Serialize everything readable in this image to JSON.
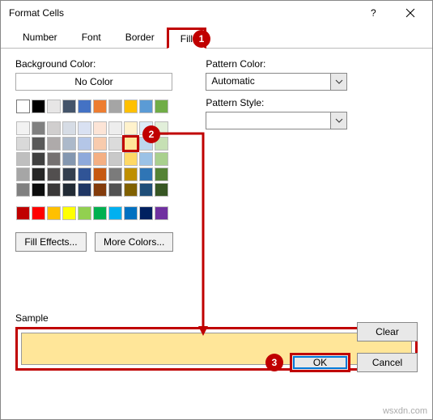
{
  "title": "Format Cells",
  "tabs": {
    "number": "Number",
    "font": "Font",
    "border": "Border",
    "fill": "Fill"
  },
  "callouts": {
    "tab": "1",
    "swatch": "2",
    "ok": "3"
  },
  "bg_label": "Background Color:",
  "no_color": "No Color",
  "pattern_color_label": "Pattern Color:",
  "pattern_color_value": "Automatic",
  "pattern_style_label": "Pattern Style:",
  "fill_effects": "Fill Effects...",
  "more_colors": "More Colors...",
  "sample_label": "Sample",
  "clear": "Clear",
  "ok": "OK",
  "cancel": "Cancel",
  "watermark": "wsxdn.com",
  "theme_colors_row1": [
    "#ffffff",
    "#000000",
    "#e7e6e6",
    "#44546a",
    "#4472c4",
    "#ed7d31",
    "#a5a5a5",
    "#ffc000",
    "#5b9bd5",
    "#70ad47"
  ],
  "theme_tints": [
    [
      "#f2f2f2",
      "#808080",
      "#d0cece",
      "#d6dce5",
      "#d9e1f2",
      "#fce4d6",
      "#ededed",
      "#fff2cc",
      "#ddebf7",
      "#e2efda"
    ],
    [
      "#d9d9d9",
      "#595959",
      "#aeaaaa",
      "#acb9ca",
      "#b4c6e7",
      "#f8cbad",
      "#dbdbdb",
      "#ffe699",
      "#bdd7ee",
      "#c6e0b4"
    ],
    [
      "#bfbfbf",
      "#404040",
      "#757171",
      "#8497b0",
      "#8ea9db",
      "#f4b084",
      "#c9c9c9",
      "#ffd966",
      "#9bc2e6",
      "#a9d08e"
    ],
    [
      "#a6a6a6",
      "#262626",
      "#524f4f",
      "#333f4f",
      "#305496",
      "#c65911",
      "#7b7b7b",
      "#bf8f00",
      "#2f75b5",
      "#548235"
    ],
    [
      "#808080",
      "#0d0d0d",
      "#3a3838",
      "#222b35",
      "#203764",
      "#833c0c",
      "#525252",
      "#806000",
      "#1f4e78",
      "#375623"
    ]
  ],
  "standard_colors": [
    "#c00000",
    "#ff0000",
    "#ffc000",
    "#ffff00",
    "#92d050",
    "#00b050",
    "#00b0f0",
    "#0070c0",
    "#002060",
    "#7030a0"
  ],
  "selected_color": "#ffe699"
}
